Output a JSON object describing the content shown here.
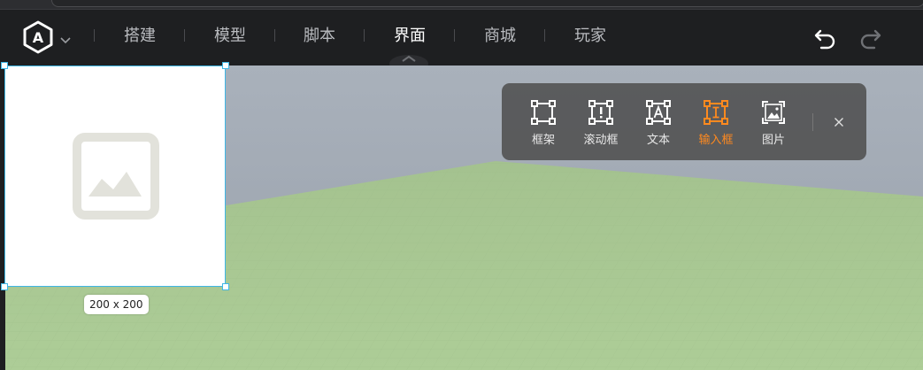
{
  "topbar": {
    "logo_icon": "hexagon-a-logo-icon",
    "logo_caret_icon": "chevron-down-icon",
    "tabs": [
      {
        "label": "搭建",
        "active": false
      },
      {
        "label": "模型",
        "active": false
      },
      {
        "label": "脚本",
        "active": false
      },
      {
        "label": "界面",
        "active": true
      },
      {
        "label": "商城",
        "active": false
      },
      {
        "label": "玩家",
        "active": false
      }
    ],
    "undo_icon": "undo-icon",
    "redo_icon": "redo-icon"
  },
  "canvas": {
    "selected_widget": {
      "type": "image",
      "placeholder_icon": "image-placeholder-icon",
      "size_label": "200 x 200"
    }
  },
  "ui_toolbar": {
    "tools": [
      {
        "label": "框架",
        "icon": "frame-icon",
        "active": false
      },
      {
        "label": "滚动框",
        "icon": "scroll-frame-icon",
        "active": false
      },
      {
        "label": "文本",
        "icon": "text-icon",
        "active": false
      },
      {
        "label": "输入框",
        "icon": "input-box-icon",
        "active": true
      },
      {
        "label": "图片",
        "icon": "image-icon",
        "active": false
      }
    ],
    "close_icon": "close-icon"
  },
  "colors": {
    "accent_active": "#ff8a1f",
    "selection_blue": "#3fb7e6",
    "sky": "#a4adb8",
    "ground": "#a8c893",
    "topbar_bg": "#1e1f21"
  }
}
